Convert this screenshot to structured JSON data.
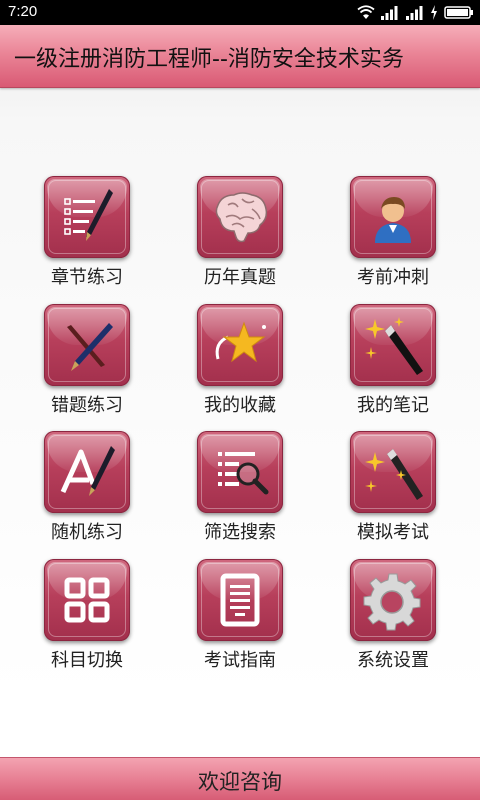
{
  "status_bar": {
    "time": "7:20"
  },
  "header": {
    "title": "一级注册消防工程师--消防安全技术实务"
  },
  "menu": {
    "items": [
      {
        "label": "章节练习",
        "icon": "checklist-pen-icon"
      },
      {
        "label": "历年真题",
        "icon": "brain-icon"
      },
      {
        "label": "考前冲刺",
        "icon": "user-avatar-icon"
      },
      {
        "label": "错题练习",
        "icon": "crossed-pens-icon"
      },
      {
        "label": "我的收藏",
        "icon": "star-icon"
      },
      {
        "label": "我的笔记",
        "icon": "magic-wand-icon"
      },
      {
        "label": "随机练习",
        "icon": "random-pen-icon"
      },
      {
        "label": "筛选搜索",
        "icon": "list-search-icon"
      },
      {
        "label": "模拟考试",
        "icon": "sparkle-wand-icon"
      },
      {
        "label": "科目切换",
        "icon": "grid-switch-icon"
      },
      {
        "label": "考试指南",
        "icon": "document-guide-icon"
      },
      {
        "label": "系统设置",
        "icon": "gear-icon"
      }
    ]
  },
  "footer": {
    "label": "欢迎咨询"
  },
  "colors": {
    "title_bar": "#e8889a",
    "tile": "#b73f5b",
    "footer": "#e77f93"
  }
}
